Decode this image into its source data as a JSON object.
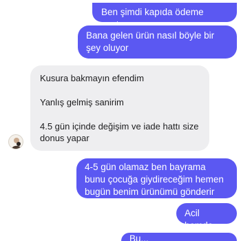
{
  "messages": [
    {
      "id": "m1",
      "direction": "outgoing",
      "text": "Ben şimdi kapıda ödeme yaptım"
    },
    {
      "id": "m2",
      "direction": "outgoing",
      "text": "Bana gelen ürün nasıl böyle bir şey oluyor"
    },
    {
      "id": "m3",
      "direction": "incoming",
      "lines": [
        "Kusura bakmayın efendim",
        "Yanlış gelmiş sanirim",
        "4.5 gün içinde değişim ve iade hattı size donus yapar"
      ]
    },
    {
      "id": "m4",
      "direction": "outgoing",
      "text": "4-5 gün olamaz ben bayrama bunu çocuğa giydireceğim hemen bugün benim ürünümü gönderir misiniz ?"
    },
    {
      "id": "m5",
      "direction": "outgoing",
      "text": "Acil hemde"
    },
    {
      "id": "m6",
      "direction": "outgoing",
      "text": "Bu..."
    }
  ],
  "colors": {
    "outgoing_bubble": "#5b58f2",
    "incoming_bubble": "#eeeef0",
    "outgoing_text": "#ffffff",
    "incoming_text": "#1c1c1e"
  },
  "avatar": {
    "icon": "contact-avatar-icon"
  }
}
